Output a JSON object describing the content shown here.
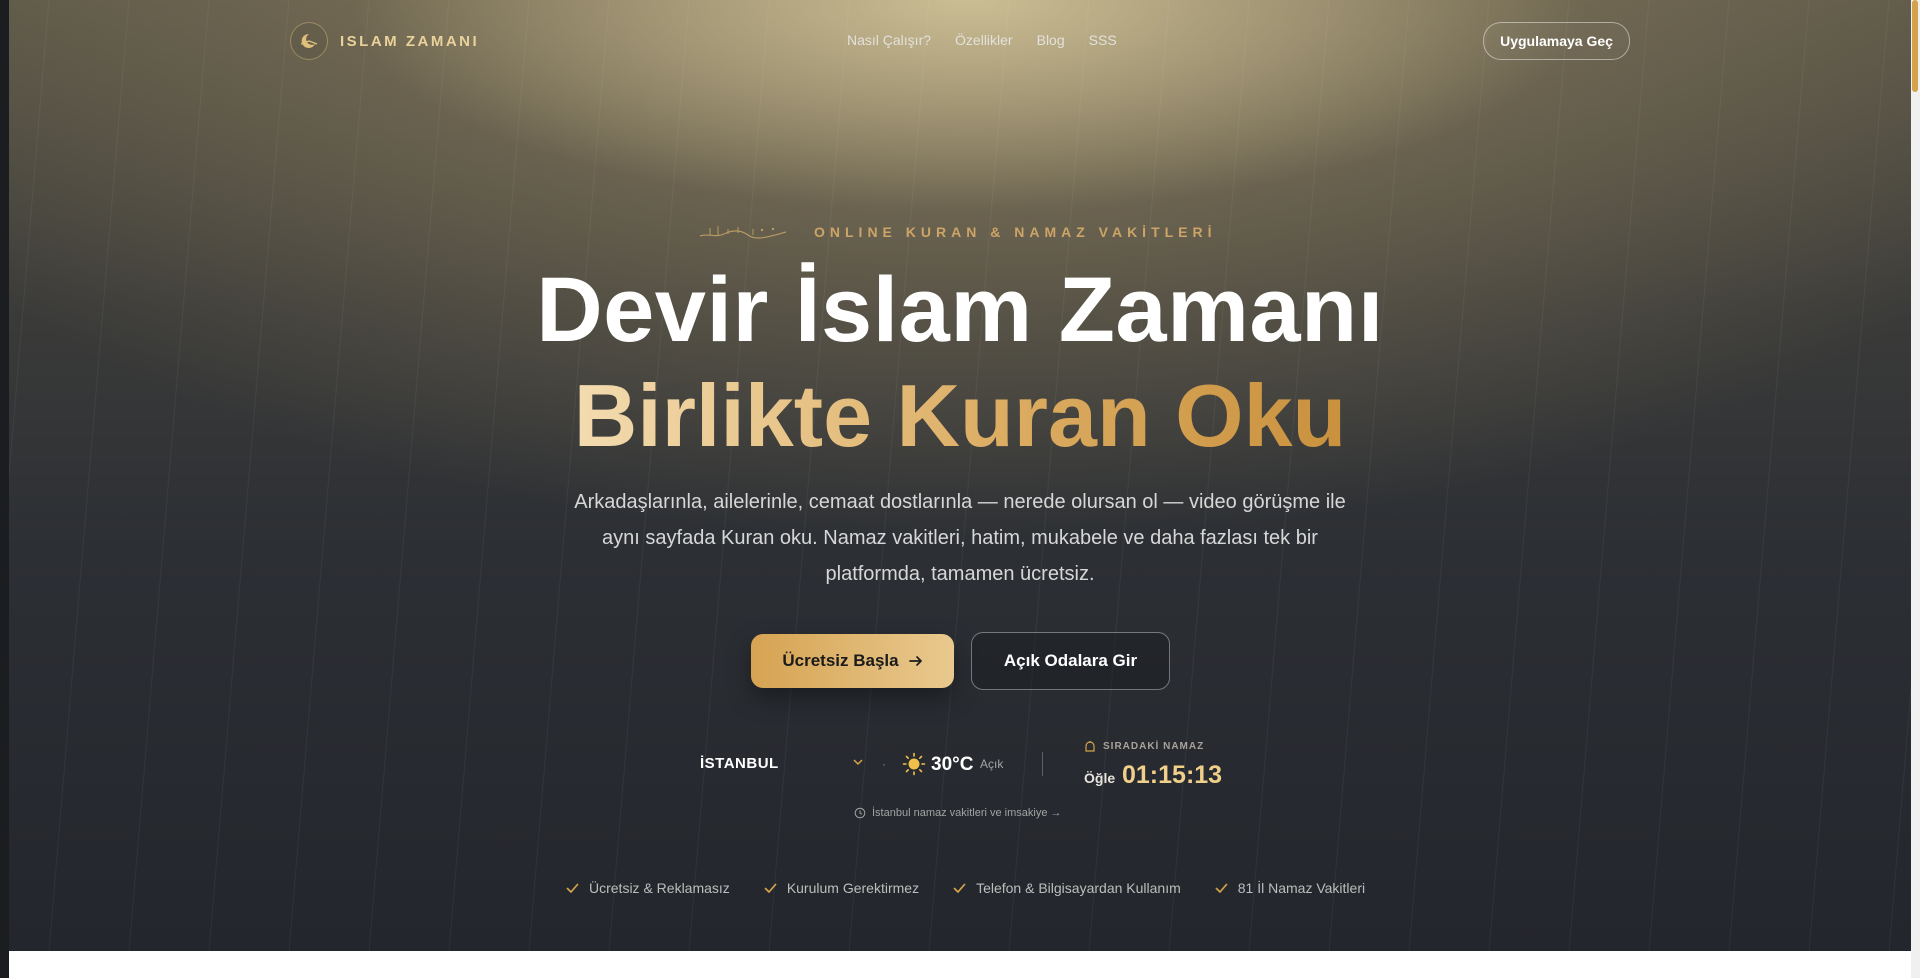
{
  "brand": {
    "name": "ISLAM ZAMANI"
  },
  "nav": {
    "links": [
      "Nasıl Çalışır?",
      "Özellikler",
      "Blog",
      "SSS"
    ],
    "cta_label": "Uygulamaya Geç"
  },
  "hero": {
    "eyebrow": "ONLINE KURAN & NAMAZ VAKİTLERİ",
    "title_line1": "Devir İslam Zamanı",
    "title_line2": "Birlikte Kuran Oku",
    "lead": "Arkadaşlarınla, ailelerinle, cemaat dostlarınla — nerede olursan ol — video görüşme ile aynı sayfada Kuran oku. Namaz vakitleri, hatim, mukabele ve daha fazlası tek bir platformda, tamamen ücretsiz.",
    "primary_button": "Ücretsiz Başla",
    "secondary_button": "Açık Odalara Gir"
  },
  "prayer_widget": {
    "city": "İSTANBUL",
    "temperature": "30°C",
    "weather": "Açık",
    "next_label": "SIRADAKİ NAMAZ",
    "next_prayer": "Öğle",
    "countdown": "01:15:13",
    "imsakiye_link": "İstanbul namaz vakitleri ve imsakiye →"
  },
  "features": [
    "Ücretsiz & Reklamasız",
    "Kurulum Gerektirmez",
    "Telefon & Bilgisayardan Kullanım",
    "81 İl Namaz Vakitleri"
  ],
  "colors": {
    "gold": "#dcad63",
    "gold_light": "#f3dcb0",
    "bg_dark": "#23262c"
  },
  "icons": {
    "logo": "crescent-emblem-icon",
    "eyebrow": "calligraphy-basmala-icon",
    "primary_button": "arrow-right-icon",
    "city": "chevron-down-icon",
    "weather": "sun-icon",
    "next_prayer": "mosque-icon",
    "imsakiye": "clock-icon",
    "features": "check-icon"
  }
}
